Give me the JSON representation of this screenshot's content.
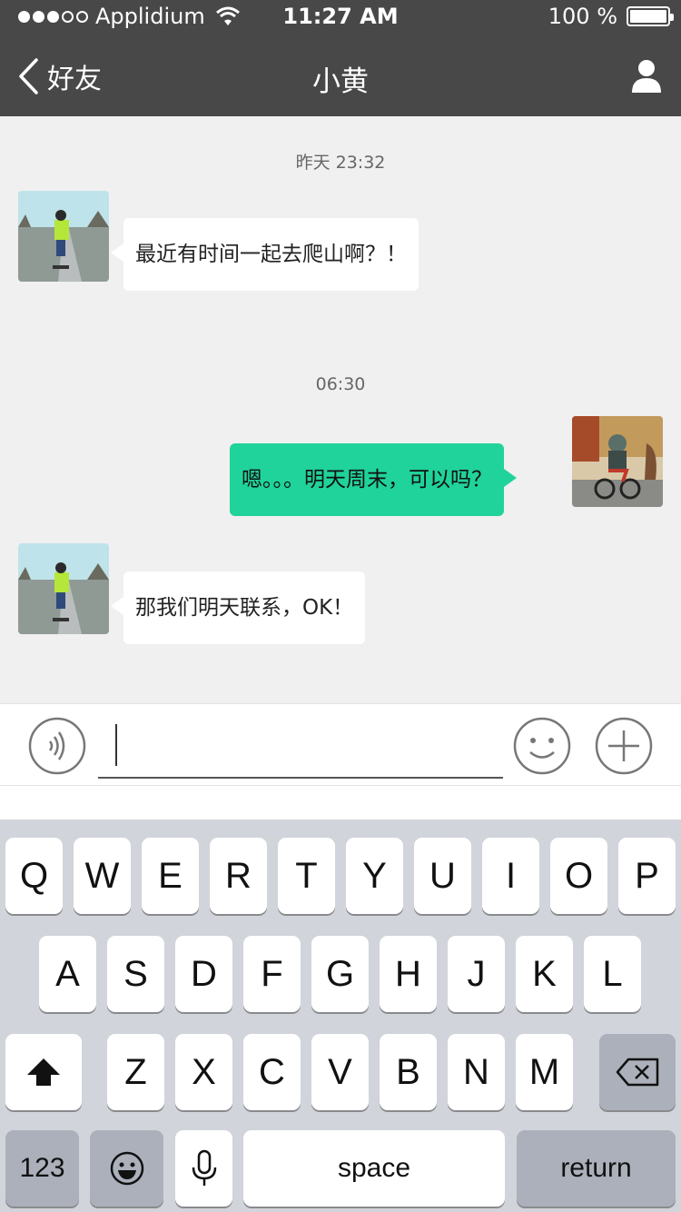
{
  "status_bar": {
    "carrier": "Applidium",
    "time": "11:27 AM",
    "battery": "100 %",
    "signal_icon": "signal-dots-icon",
    "wifi_icon": "wifi-icon",
    "battery_icon": "battery-icon"
  },
  "nav": {
    "back_label": "好友",
    "title": "小黄",
    "back_icon": "chevron-left-icon",
    "profile_icon": "person-icon"
  },
  "chat": {
    "messages": [
      {
        "timestamp": "昨天 23:32",
        "side": "left",
        "text": "最近有时间一起去爬山啊？！",
        "avatar": "friend-avatar"
      },
      {
        "timestamp": "06:30",
        "side": "right",
        "text": "嗯。。。明天周末，可以吗？",
        "avatar": "my-avatar"
      },
      {
        "side": "left",
        "text": "那我们明天联系，OK！",
        "avatar": "friend-avatar"
      }
    ]
  },
  "input": {
    "value": "",
    "voice_icon": "voice-icon",
    "emoji_icon": "emoji-icon",
    "plus_icon": "plus-icon"
  },
  "keyboard": {
    "row1": [
      "Q",
      "W",
      "E",
      "R",
      "T",
      "Y",
      "U",
      "I",
      "O",
      "P"
    ],
    "row2": [
      "A",
      "S",
      "D",
      "F",
      "G",
      "H",
      "J",
      "K",
      "L"
    ],
    "row3": [
      "Z",
      "X",
      "C",
      "V",
      "B",
      "N",
      "M"
    ],
    "numbers_label": "123",
    "space_label": "space",
    "return_label": "return"
  },
  "colors": {
    "header_bg": "#484848",
    "my_bubble": "#20d39a",
    "chat_bg": "#f0f0f0",
    "keyboard_bg": "#d1d4da"
  }
}
